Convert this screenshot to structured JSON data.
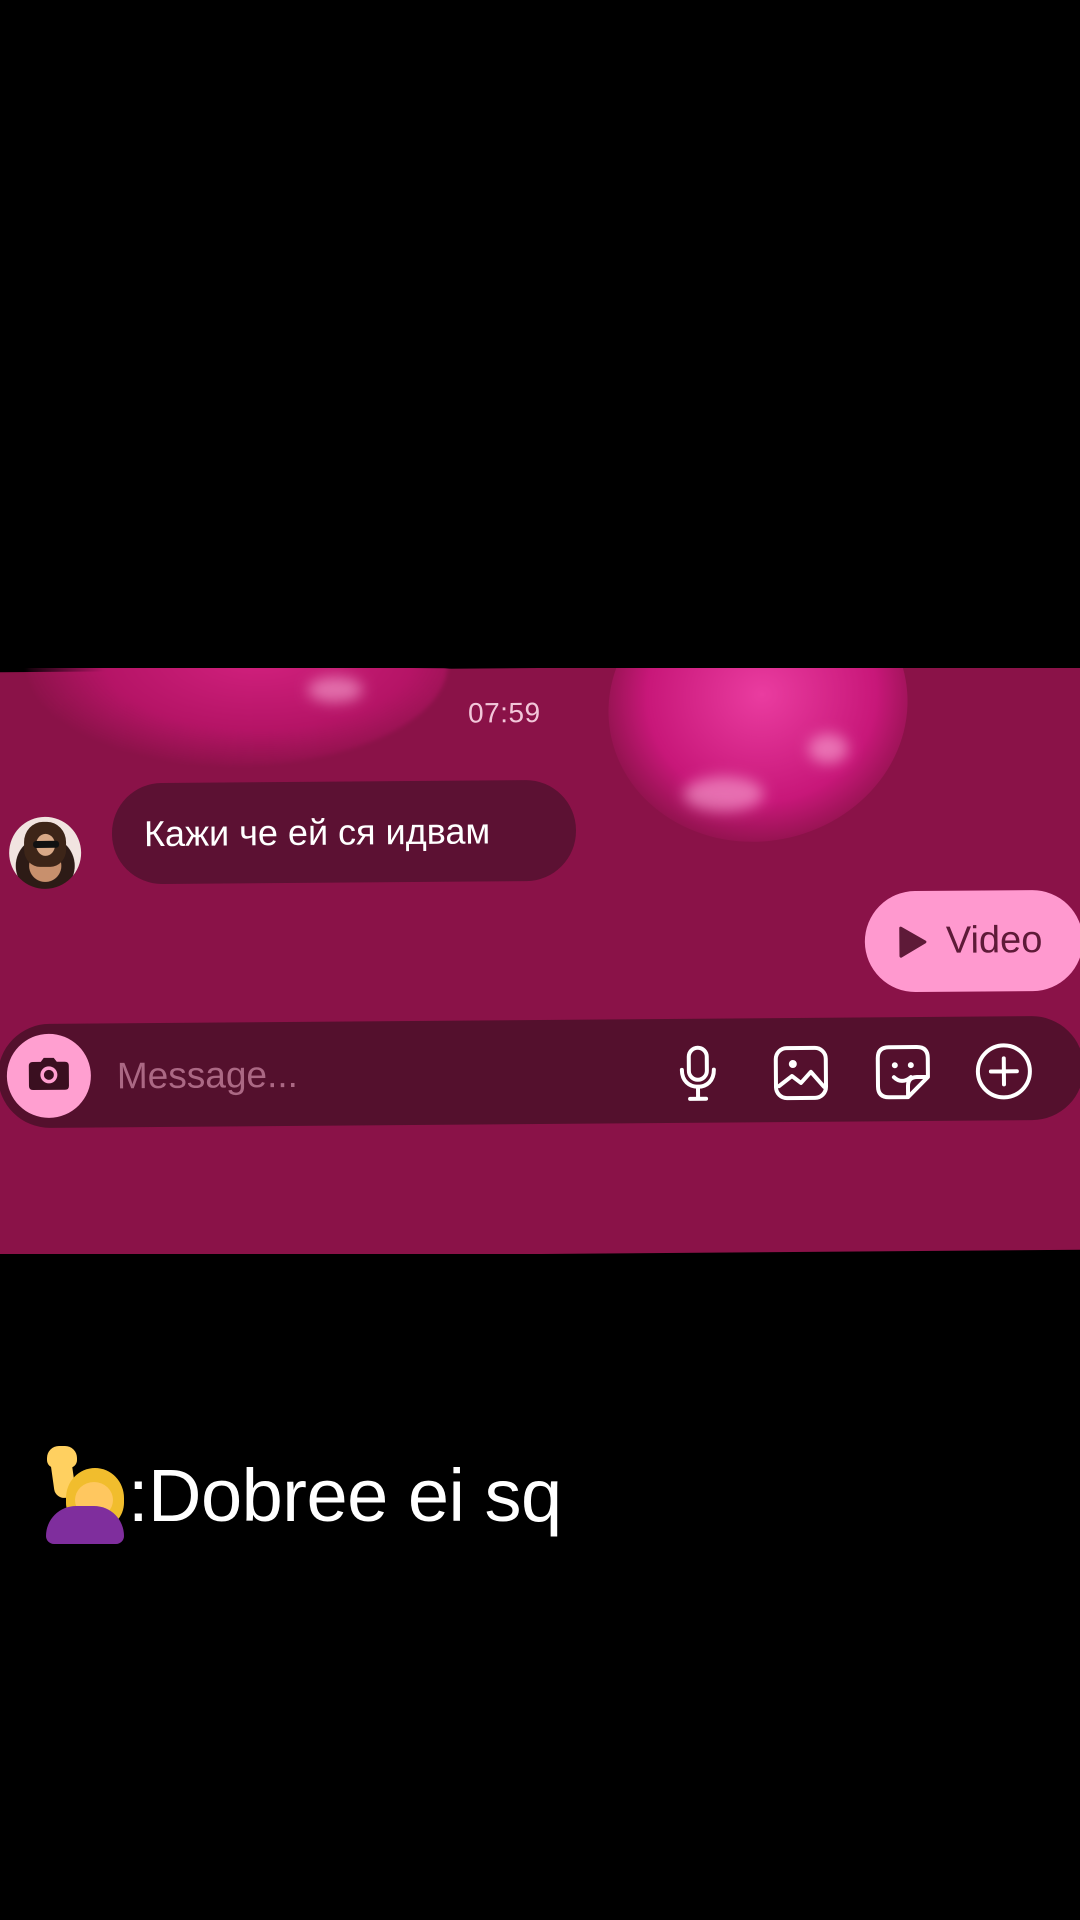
{
  "conversation": {
    "timestamp": "07:59",
    "messages": [
      {
        "direction": "incoming",
        "text": "Кажи че ей ся идвам"
      }
    ],
    "video_chip": {
      "label": "Video"
    }
  },
  "composer": {
    "placeholder": "Message..."
  },
  "caption": {
    "text": ":Dobree ei sq",
    "emoji": "person raising hand"
  },
  "colors": {
    "chat_background": "#8a1248",
    "incoming_bubble": "#5c1133",
    "video_chip": "#ff99cf",
    "composer": "#54102d",
    "camera_button": "#ff9fd0",
    "caption_text": "#ffffff"
  },
  "icons": {
    "camera": "camera-icon",
    "play": "play-icon",
    "mic": "microphone-icon",
    "gallery": "gallery-icon",
    "sticker": "sticker-icon",
    "plus": "plus-circle-icon"
  }
}
